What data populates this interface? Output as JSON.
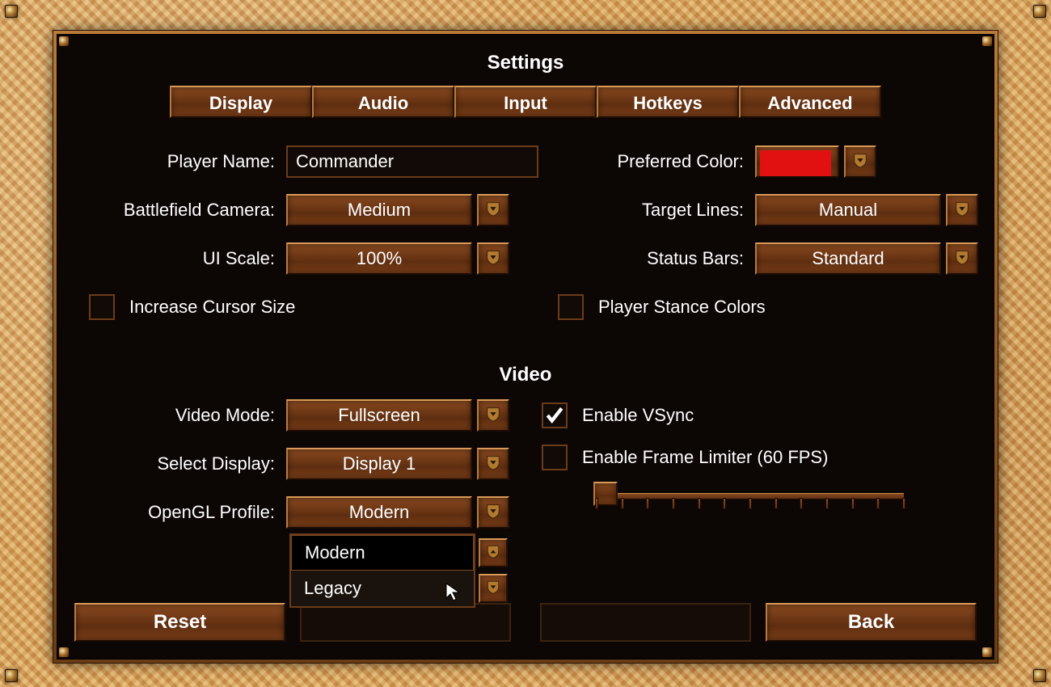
{
  "titles": {
    "settings": "Settings",
    "video": "Video"
  },
  "tabs": [
    "Display",
    "Audio",
    "Input",
    "Hotkeys",
    "Advanced"
  ],
  "active_tab_index": 0,
  "labels": {
    "player_name": "Player Name:",
    "battlefield_camera": "Battlefield Camera:",
    "ui_scale": "UI Scale:",
    "preferred_color": "Preferred Color:",
    "target_lines": "Target Lines:",
    "status_bars": "Status Bars:",
    "increase_cursor": "Increase Cursor Size",
    "stance_colors": "Player Stance Colors",
    "video_mode": "Video Mode:",
    "select_display": "Select Display:",
    "opengl_profile": "OpenGL Profile:",
    "enable_vsync": "Enable VSync",
    "enable_frame_limiter": "Enable Frame Limiter (60 FPS)"
  },
  "values": {
    "player_name": "Commander",
    "battlefield_camera": "Medium",
    "ui_scale": "100%",
    "preferred_color": "#e11111",
    "target_lines": "Manual",
    "status_bars": "Standard",
    "increase_cursor": false,
    "stance_colors": false,
    "video_mode": "Fullscreen",
    "select_display": "Display 1",
    "opengl_profile": "Modern",
    "enable_vsync": true,
    "enable_frame_limiter": false,
    "frame_limiter_slider": 0.03
  },
  "opengl_dropdown": {
    "open": true,
    "options": [
      "Modern",
      "Legacy"
    ],
    "selected_index": 0
  },
  "buttons": {
    "reset": "Reset",
    "back": "Back"
  },
  "colors": {
    "accent_wood": "#7a3e18",
    "panel_bg": "#0c0605",
    "swatch_red": "#e11111"
  }
}
